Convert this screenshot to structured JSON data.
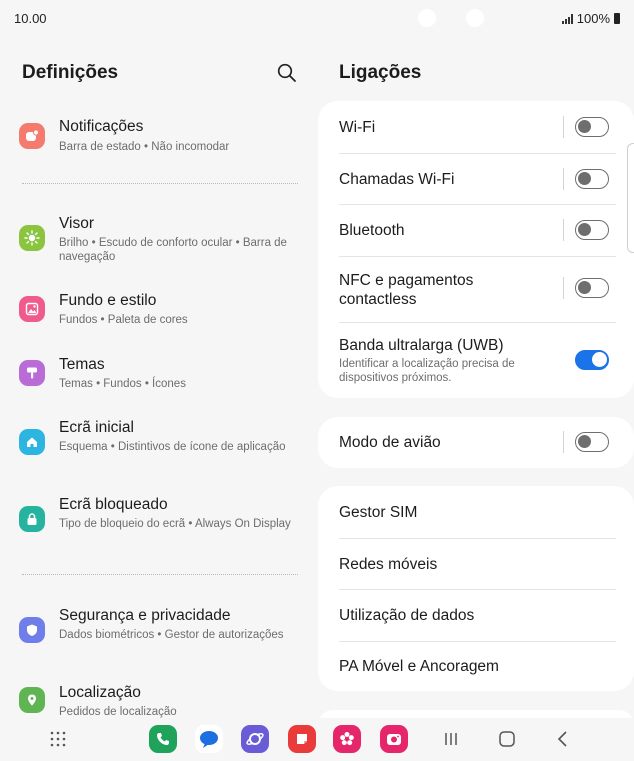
{
  "status_bar": {
    "time": "10.00",
    "battery": "100%"
  },
  "left_pane": {
    "title": "Definições",
    "items": [
      {
        "title": "Notificações",
        "subtitle": "Barra de estado  •  Não incomodar",
        "icon": "notifications-icon",
        "color": "#f47b6e"
      },
      {
        "title": "Visor",
        "subtitle": "Brilho  •  Escudo de conforto ocular  •  Barra de navegação",
        "icon": "display-sun-icon",
        "color": "#8bc53f"
      },
      {
        "title": "Fundo e estilo",
        "subtitle": "Fundos  •  Paleta de cores",
        "icon": "wallpaper-icon",
        "color": "#ef5b8c"
      },
      {
        "title": "Temas",
        "subtitle": "Temas  •  Fundos  •  Ícones",
        "icon": "themes-brush-icon",
        "color": "#b96bd6"
      },
      {
        "title": "Ecrã inicial",
        "subtitle": "Esquema  •  Distintivos de ícone de aplicação",
        "icon": "home-icon",
        "color": "#2bb5e0"
      },
      {
        "title": "Ecrã bloqueado",
        "subtitle": "Tipo de bloqueio do ecrã  •  Always On Display",
        "icon": "lock-icon",
        "color": "#26b4a0"
      },
      {
        "title": "Segurança e privacidade",
        "subtitle": "Dados biométricos  •  Gestor de autorizações",
        "icon": "shield-icon",
        "color": "#6f7ee8"
      },
      {
        "title": "Localização",
        "subtitle": "Pedidos de localização",
        "icon": "location-pin-icon",
        "color": "#5fb551"
      }
    ]
  },
  "right_pane": {
    "title": "Ligações",
    "card1": [
      {
        "label": "Wi-Fi",
        "toggle": false
      },
      {
        "label": "Chamadas Wi-Fi",
        "toggle": false
      },
      {
        "label": "Bluetooth",
        "toggle": false
      },
      {
        "label": "NFC e pagamentos contactless",
        "toggle": false
      },
      {
        "label": "Banda ultralarga (UWB)",
        "subtitle": "Identificar a localização precisa de dispositivos próximos.",
        "toggle": true
      }
    ],
    "card2": [
      {
        "label": "Modo de avião",
        "toggle": false
      }
    ],
    "card3": [
      {
        "label": "Gestor SIM"
      },
      {
        "label": "Redes móveis"
      },
      {
        "label": "Utilização de dados"
      },
      {
        "label": "PA Móvel e Ancoragem"
      }
    ]
  },
  "dock": {
    "apps": [
      {
        "icon": "phone-icon",
        "color": "#1fa35a"
      },
      {
        "icon": "messages-icon",
        "color": "#1b6fe0"
      },
      {
        "icon": "internet-browser-icon",
        "color": "#6a5bd6"
      },
      {
        "icon": "notes-icon",
        "color": "#ea3b3b"
      },
      {
        "icon": "gallery-flower-icon",
        "color": "#e5266a"
      },
      {
        "icon": "camera-icon",
        "color": "#e5266a"
      }
    ]
  },
  "colors": {
    "accent": "#1a73e8",
    "background": "#f6f6f6",
    "card": "#ffffff"
  }
}
